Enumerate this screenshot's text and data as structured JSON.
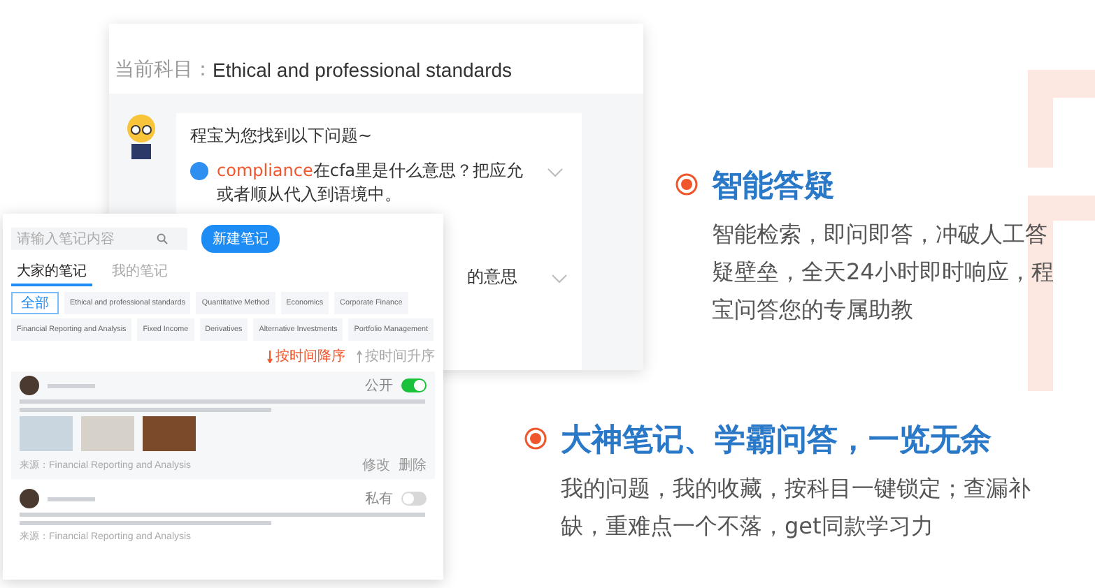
{
  "qa_window": {
    "subject_label": "当前科目：",
    "subject": "Ethical and professional standards",
    "bot_message": "程宝为您找到以下问题~",
    "questions": [
      {
        "keyword": "compliance",
        "text": "在cfa里是什么意思？把应允或者顺从代入到语境中。",
        "expanded": false
      },
      {
        "text": "的意思",
        "expanded": false
      }
    ]
  },
  "notes_panel": {
    "search": {
      "placeholder": "请输入笔记内容"
    },
    "new_button": "新建笔记",
    "tabs": [
      {
        "label": "大家的笔记",
        "selected": true
      },
      {
        "label": "我的笔记",
        "selected": false
      }
    ],
    "chips": [
      {
        "label": "全部",
        "selected": true
      },
      {
        "label": "Ethical and professional standards",
        "selected": false
      },
      {
        "label": "Quantitative Method",
        "selected": false
      },
      {
        "label": "Economics",
        "selected": false
      },
      {
        "label": "Corporate Finance",
        "selected": false
      },
      {
        "label": "Financial Reporting and Analysis",
        "selected": false
      },
      {
        "label": "Fixed Income",
        "selected": false
      },
      {
        "label": "Derivatives",
        "selected": false
      },
      {
        "label": "Alternative Investments",
        "selected": false
      },
      {
        "label": "Portfolio Management",
        "selected": false
      }
    ],
    "sort": [
      {
        "label": "按时间降序",
        "selected": true
      },
      {
        "label": "按时间升序",
        "selected": false
      }
    ],
    "notes": [
      {
        "visibility": "公开",
        "public": true,
        "has_photos": true,
        "source": "来源：Financial Reporting and Analysis",
        "actions": [
          "修改",
          "删除"
        ]
      },
      {
        "visibility": "私有",
        "public": false,
        "has_photos": false,
        "source": "来源：Financial Reporting and Analysis"
      }
    ]
  },
  "features": [
    {
      "title": "智能答疑",
      "body": "智能检索，即问即答，冲破人工答疑壁垒，全天24小时即时响应，程宝问答您的专属助教"
    },
    {
      "title": "大神笔记、学霸问答，一览无余",
      "body": "我的问题，我的收藏，按科目一键锁定；查漏补缺，重难点一个不落，get同款学习力"
    }
  ]
}
